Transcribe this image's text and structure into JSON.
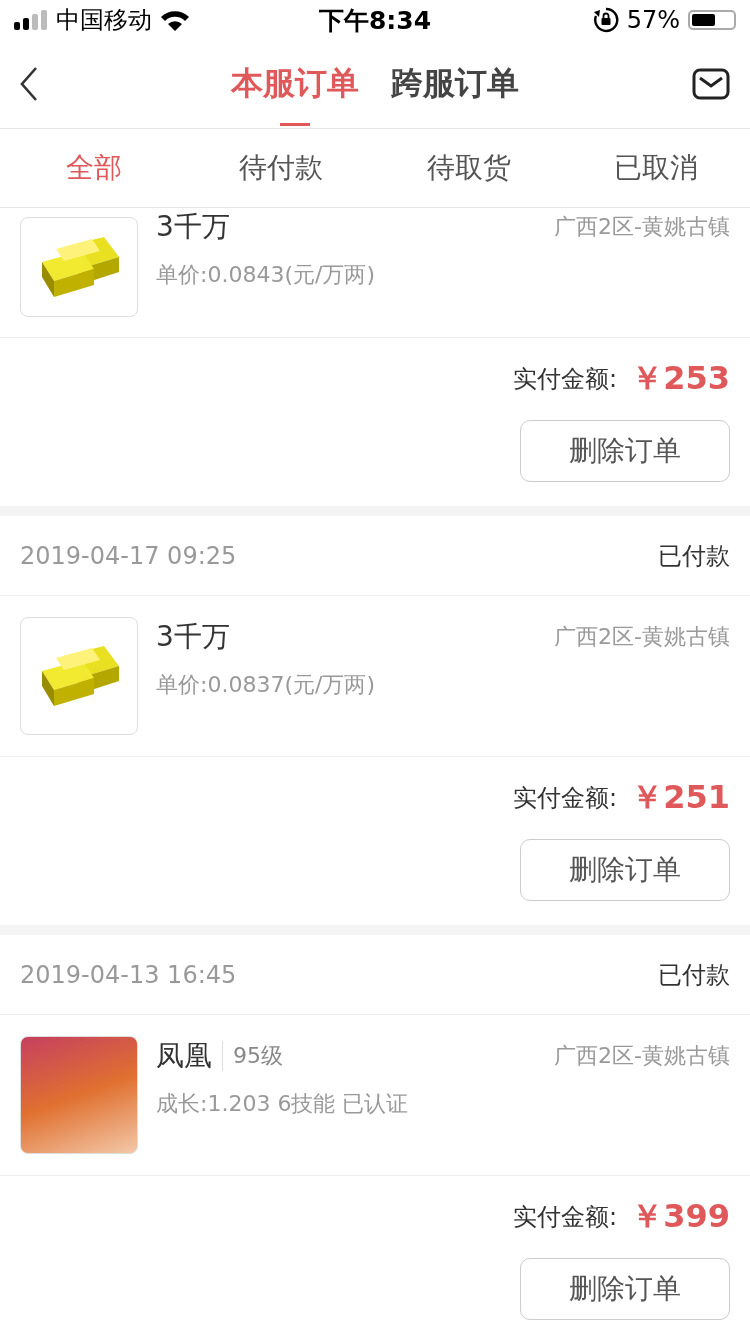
{
  "status_bar": {
    "carrier": "中国移动",
    "time": "下午8:34",
    "battery": "57%"
  },
  "nav": {
    "tabs": [
      {
        "label": "本服订单",
        "selected": true
      },
      {
        "label": "跨服订单",
        "selected": false
      }
    ]
  },
  "filters": [
    {
      "label": "全部",
      "selected": true
    },
    {
      "label": "待付款",
      "selected": false
    },
    {
      "label": "待取货",
      "selected": false
    },
    {
      "label": "已取消",
      "selected": false
    }
  ],
  "orders": [
    {
      "product": {
        "kind": "gold",
        "name": "3千万",
        "detail": "单价:0.0843(元/万两)",
        "server": "广西2区-黄姚古镇"
      },
      "amount_label": "实付金额:",
      "amount": "￥253",
      "button": "删除订单"
    },
    {
      "date": "2019-04-17 09:25",
      "status": "已付款",
      "product": {
        "kind": "gold",
        "name": "3千万",
        "detail": "单价:0.0837(元/万两)",
        "server": "广西2区-黄姚古镇"
      },
      "amount_label": "实付金额:",
      "amount": "￥251",
      "button": "删除订单"
    },
    {
      "date": "2019-04-13 16:45",
      "status": "已付款",
      "product": {
        "kind": "character",
        "name": "凤凰",
        "level": "95级",
        "detail": "成长:1.203 6技能 已认证",
        "server": "广西2区-黄姚古镇"
      },
      "amount_label": "实付金额:",
      "amount": "￥399",
      "button": "删除订单"
    }
  ]
}
